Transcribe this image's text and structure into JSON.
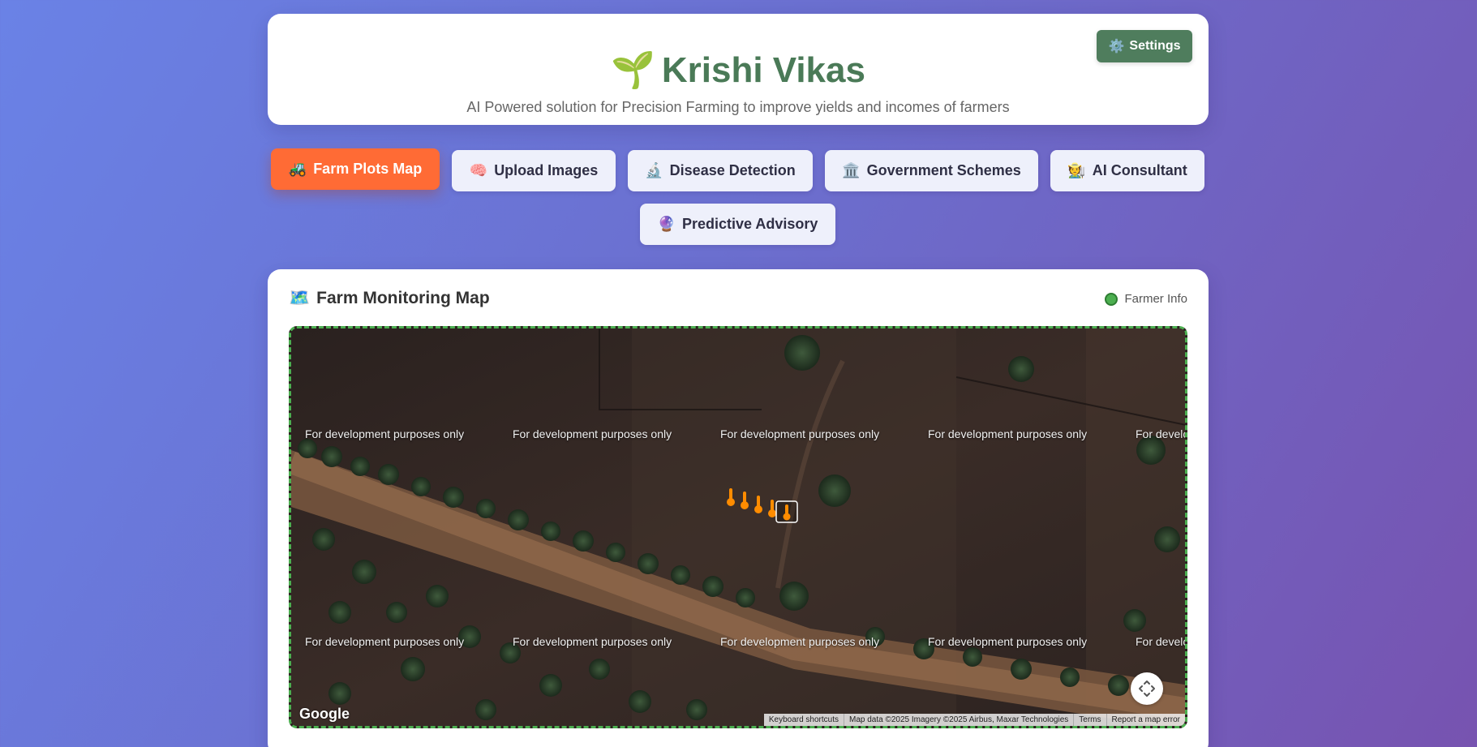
{
  "header": {
    "logo_emoji": "🌱",
    "title": "Krishi Vikas",
    "subtitle": "AI Powered solution for Precision Farming to improve yields and incomes of farmers",
    "settings": {
      "icon": "⚙️",
      "label": "Settings"
    }
  },
  "tabs": [
    {
      "icon": "🚜",
      "label": "Farm Plots Map",
      "active": true
    },
    {
      "icon": "🧠",
      "label": "Upload Images",
      "active": false
    },
    {
      "icon": "🔬",
      "label": "Disease Detection",
      "active": false
    },
    {
      "icon": "🏛️",
      "label": "Government Schemes",
      "active": false
    },
    {
      "icon": "🧑‍🌾",
      "label": "AI Consultant",
      "active": false
    },
    {
      "icon": "🔮",
      "label": "Predictive Advisory",
      "active": false
    }
  ],
  "map_section": {
    "icon": "🗺️",
    "title": "Farm Monitoring Map",
    "legend_label": "Farmer Info",
    "legend_color": "#4caf50",
    "watermark": "For development purposes only",
    "google_logo": "Google",
    "attribution": [
      "Keyboard shortcuts",
      "Map data ©2025 Imagery ©2025 Airbus, Maxar Technologies",
      "Terms",
      "Report a map error"
    ]
  },
  "colors": {
    "accent": "#ff6b35",
    "brand": "#4a7a57",
    "marker": "#ff8c00"
  }
}
